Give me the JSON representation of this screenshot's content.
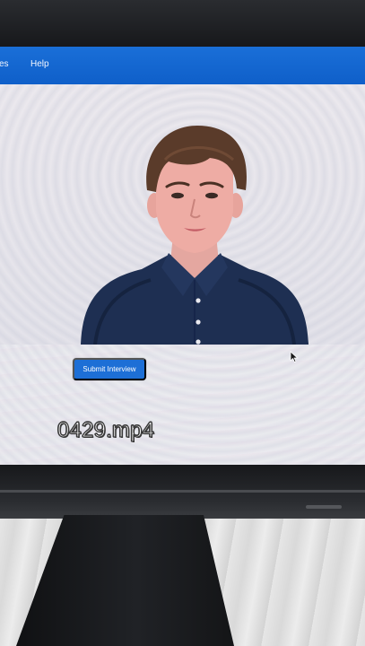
{
  "navbar": {
    "items": [
      {
        "label": "ces"
      },
      {
        "label": "Help"
      }
    ],
    "color": "#1565d8"
  },
  "video": {
    "subject": "avatar-person"
  },
  "actions": {
    "submit_label": "Submit Interview",
    "submit_color": "#1d6fd6"
  },
  "overlay": {
    "filename": "0429.mp4"
  },
  "icons": [
    "mouse-cursor-icon"
  ]
}
